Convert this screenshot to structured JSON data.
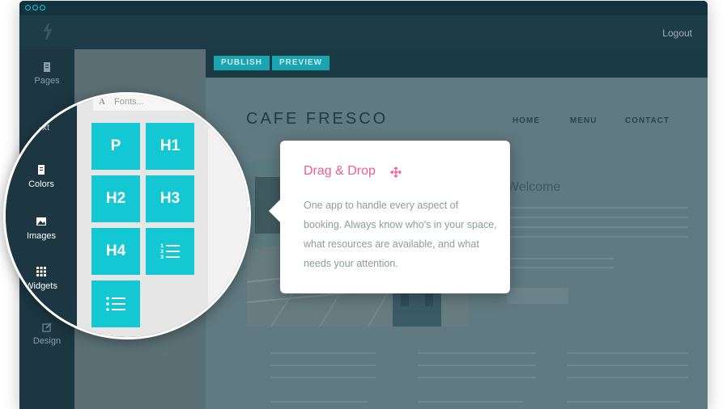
{
  "window": {
    "accent": "#14c8d3",
    "logout": "Logout"
  },
  "sidebar": {
    "items": [
      {
        "label": "Pages",
        "icon": "page-icon"
      },
      {
        "label": "Text",
        "icon": "text-icon"
      },
      {
        "label": "Colors",
        "icon": "colors-icon"
      },
      {
        "label": "Images",
        "icon": "image-icon"
      },
      {
        "label": "Widgets",
        "icon": "grid-icon"
      },
      {
        "label": "Design",
        "icon": "edit-icon"
      }
    ]
  },
  "toolbar": {
    "publish": "PUBLISH",
    "preview": "PREVIEW"
  },
  "site": {
    "title": "CAFE FRESCO",
    "nav": [
      "HOME",
      "MENU",
      "CONTACT"
    ],
    "welcome": "Welcome"
  },
  "text_panel": {
    "fonts_label": "Fonts...",
    "tiles": [
      "P",
      "H1",
      "H2",
      "H3",
      "H4"
    ],
    "ordered_list_icon": "ordered-list-icon",
    "bullet_list_icon": "bullet-list-icon"
  },
  "popover": {
    "title": "Drag & Drop",
    "title_color": "#ef5d8c",
    "icon": "move-icon",
    "body": "One app to handle every aspect of booking. Always know who's in your space, what resources are available, and what needs your attention."
  }
}
